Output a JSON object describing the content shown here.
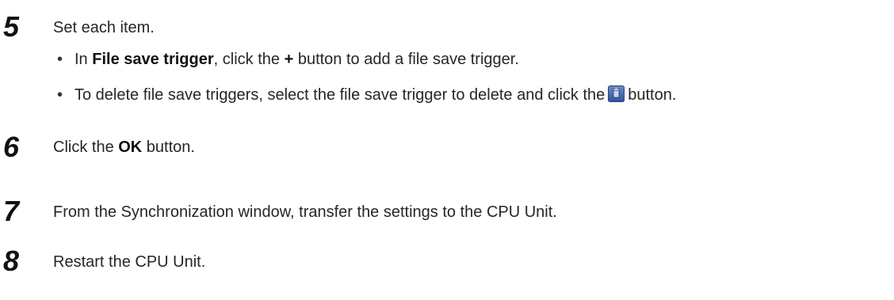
{
  "steps": [
    {
      "number": "5",
      "text": "Set each item.",
      "bullets": [
        {
          "dot": "•",
          "pre": "In ",
          "bold": "File save trigger",
          "mid": ", click the ",
          "bold2": "+",
          "post": " button to add a file save trigger."
        },
        {
          "dot": "•",
          "pre": "To delete file save triggers, select the file save trigger to delete and click the",
          "icon": "trash-icon",
          "post": "button."
        }
      ]
    },
    {
      "number": "6",
      "pre": "Click the ",
      "bold": "OK",
      "post": " button."
    },
    {
      "number": "7",
      "text": "From the Synchronization window, transfer the settings to the CPU Unit."
    },
    {
      "number": "8",
      "text": "Restart the CPU Unit."
    }
  ]
}
